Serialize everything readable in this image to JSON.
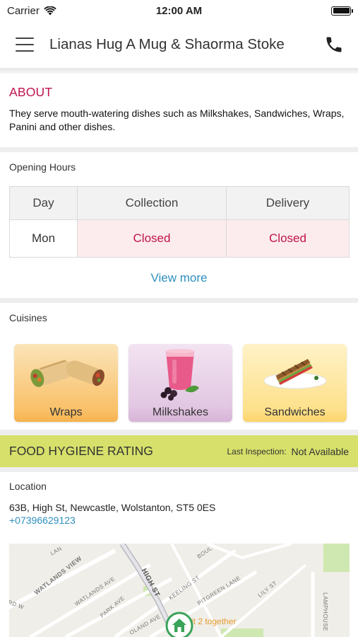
{
  "status_bar": {
    "carrier": "Carrier",
    "time": "12:00 AM"
  },
  "nav": {
    "title": "Lianas Hug A Mug & Shaorma Stoke",
    "menu_icon": "hamburger-menu-icon",
    "call_icon": "phone-icon"
  },
  "about": {
    "title": "ABOUT",
    "text": "They serve mouth-watering dishes such as Milkshakes, Sandwiches, Wraps, Panini and other dishes."
  },
  "opening_hours": {
    "title": "Opening Hours",
    "headers": [
      "Day",
      "Collection",
      "Delivery"
    ],
    "rows": [
      {
        "day": "Mon",
        "collection": "Closed",
        "delivery": "Closed"
      }
    ],
    "view_more": "View more"
  },
  "cuisines": {
    "title": "Cuisines",
    "items": [
      {
        "label": "Wraps",
        "icon": "wraps-image"
      },
      {
        "label": "Milkshakes",
        "icon": "milkshake-image"
      },
      {
        "label": "Sandwiches",
        "icon": "sandwich-image"
      }
    ]
  },
  "hygiene": {
    "title": "FOOD HYGIENE RATING",
    "inspection_label": "Last Inspection:",
    "inspection_value": "Not Available"
  },
  "location": {
    "title": "Location",
    "address": "63B, High St, Newcastle, Wolstanton, ST5 0ES",
    "phone": "+07396629123",
    "map": {
      "streets": [
        "WATLANDS VIEW",
        "WATLANDS AVE",
        "PARK AVE",
        "HIGH ST",
        "KEELING ST",
        "PITGREEN LANE",
        "LILY ST",
        "BOUL",
        "LAMPHOUSE",
        "RD W",
        "OLAND AVE",
        "LAN"
      ],
      "overlay_label": "it 2 together",
      "pin_icon": "home-pin-icon"
    }
  },
  "colors": {
    "accent": "#c0134e",
    "link": "#2e8fbf",
    "hygiene_bar": "#d6e06a",
    "closed_bg": "#fdeced"
  }
}
